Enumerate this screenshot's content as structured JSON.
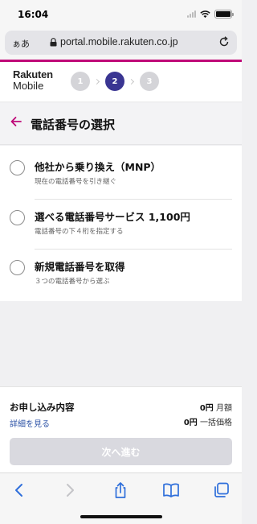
{
  "status_bar": {
    "time": "16:04"
  },
  "browser": {
    "aa_label": "ぁあ",
    "url": "portal.mobile.rakuten.co.jp"
  },
  "header": {
    "logo_line1": "Rakuten",
    "logo_line2": "Mobile",
    "steps": [
      {
        "label": "1",
        "state": "inactive"
      },
      {
        "label": "2",
        "state": "active"
      },
      {
        "label": "3",
        "state": "inactive"
      }
    ]
  },
  "page": {
    "title": "電話番号の選択"
  },
  "options": [
    {
      "title": "他社から乗り換え（MNP）",
      "subtitle": "現在の電話番号を引き継ぐ"
    },
    {
      "title": "選べる電話番号サービス 1,100円",
      "subtitle": "電話番号の下４桁を指定する"
    },
    {
      "title": "新規電話番号を取得",
      "subtitle": "３つの電話番号から選ぶ"
    }
  ],
  "summary": {
    "title": "お申し込み内容",
    "details_link": "詳細を見る",
    "monthly_amount": "0円",
    "monthly_label": "月額",
    "onetime_amount": "0円",
    "onetime_label": "一括価格",
    "next_button": "次へ進む"
  },
  "colors": {
    "brand_pink": "#bf0a78",
    "step_active": "#3a3592",
    "step_inactive": "#d4d4d8",
    "link_blue": "#2b51a6",
    "toolbar_blue": "#2f6fdb",
    "button_disabled": "#d9d9df"
  },
  "toolbar": {
    "icons": [
      "back-icon",
      "forward-icon",
      "share-icon",
      "bookmarks-icon",
      "tabs-icon"
    ]
  }
}
